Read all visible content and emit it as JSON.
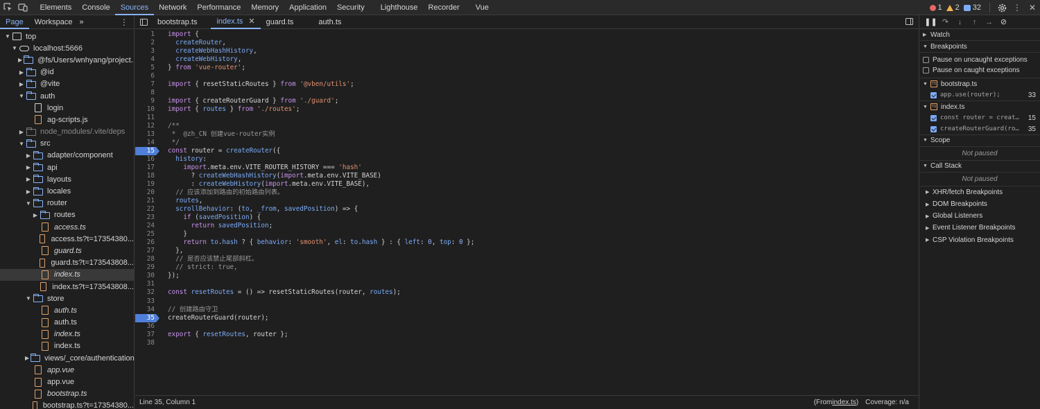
{
  "main_tabs": [
    "Elements",
    "Console",
    "Sources",
    "Network",
    "Performance",
    "Memory",
    "Application",
    "Security",
    "Lighthouse",
    "Recorder",
    "Vue"
  ],
  "active_main_tab": "Sources",
  "counts": {
    "errors": "1",
    "warnings": "2",
    "messages": "32"
  },
  "navigator": {
    "tabs": [
      "Page",
      "Workspace"
    ],
    "tree": [
      {
        "label": "top",
        "depth": 0,
        "arrow": "down",
        "icon": "frame"
      },
      {
        "label": "localhost:5666",
        "depth": 1,
        "arrow": "down",
        "icon": "cloud"
      },
      {
        "label": "@fs/Users/wnhyang/project...",
        "depth": 2,
        "arrow": "right",
        "icon": "folder"
      },
      {
        "label": "@id",
        "depth": 2,
        "arrow": "right",
        "icon": "folder"
      },
      {
        "label": "@vite",
        "depth": 2,
        "arrow": "right",
        "icon": "folder"
      },
      {
        "label": "auth",
        "depth": 2,
        "arrow": "down",
        "icon": "folder"
      },
      {
        "label": "login",
        "depth": 3,
        "arrow": "none",
        "icon": "file-white"
      },
      {
        "label": "ag-scripts.js",
        "depth": 3,
        "arrow": "none",
        "icon": "file"
      },
      {
        "label": "node_modules/.vite/deps",
        "depth": 2,
        "arrow": "right",
        "icon": "folder-dim",
        "dim": true
      },
      {
        "label": "src",
        "depth": 2,
        "arrow": "down",
        "icon": "folder"
      },
      {
        "label": "adapter/component",
        "depth": 3,
        "arrow": "right",
        "icon": "folder"
      },
      {
        "label": "api",
        "depth": 3,
        "arrow": "right",
        "icon": "folder"
      },
      {
        "label": "layouts",
        "depth": 3,
        "arrow": "right",
        "icon": "folder"
      },
      {
        "label": "locales",
        "depth": 3,
        "arrow": "right",
        "icon": "folder"
      },
      {
        "label": "router",
        "depth": 3,
        "arrow": "down",
        "icon": "folder"
      },
      {
        "label": "routes",
        "depth": 4,
        "arrow": "right",
        "icon": "folder"
      },
      {
        "label": "access.ts",
        "depth": 4,
        "arrow": "none",
        "icon": "file",
        "italic": true
      },
      {
        "label": "access.ts?t=17354380...",
        "depth": 4,
        "arrow": "none",
        "icon": "file"
      },
      {
        "label": "guard.ts",
        "depth": 4,
        "arrow": "none",
        "icon": "file",
        "italic": true
      },
      {
        "label": "guard.ts?t=173543808...",
        "depth": 4,
        "arrow": "none",
        "icon": "file"
      },
      {
        "label": "index.ts",
        "depth": 4,
        "arrow": "none",
        "icon": "file",
        "italic": true,
        "selected": true
      },
      {
        "label": "index.ts?t=173543808...",
        "depth": 4,
        "arrow": "none",
        "icon": "file"
      },
      {
        "label": "store",
        "depth": 3,
        "arrow": "down",
        "icon": "folder"
      },
      {
        "label": "auth.ts",
        "depth": 4,
        "arrow": "none",
        "icon": "file",
        "italic": true
      },
      {
        "label": "auth.ts",
        "depth": 4,
        "arrow": "none",
        "icon": "file"
      },
      {
        "label": "index.ts",
        "depth": 4,
        "arrow": "none",
        "icon": "file",
        "italic": true
      },
      {
        "label": "index.ts",
        "depth": 4,
        "arrow": "none",
        "icon": "file"
      },
      {
        "label": "views/_core/authentication",
        "depth": 3,
        "arrow": "right",
        "icon": "folder"
      },
      {
        "label": "app.vue",
        "depth": 3,
        "arrow": "none",
        "icon": "file",
        "italic": true
      },
      {
        "label": "app.vue",
        "depth": 3,
        "arrow": "none",
        "icon": "file"
      },
      {
        "label": "bootstrap.ts",
        "depth": 3,
        "arrow": "none",
        "icon": "file",
        "italic": true
      },
      {
        "label": "bootstrap.ts?t=17354380...",
        "depth": 3,
        "arrow": "none",
        "icon": "file"
      }
    ]
  },
  "editor": {
    "tabs": [
      {
        "label": "bootstrap.ts",
        "active": false
      },
      {
        "label": "index.ts",
        "active": true,
        "close": "✕"
      },
      {
        "label": "guard.ts",
        "active": false
      },
      {
        "label": "auth.ts",
        "active": false
      }
    ],
    "breakpoint_lines": [
      15,
      35
    ],
    "lines": [
      "import {",
      "  createRouter,",
      "  createWebHashHistory,",
      "  createWebHistory,",
      "} from 'vue-router';",
      "",
      "import { resetStaticRoutes } from '@vben/utils';",
      "",
      "import { createRouterGuard } from './guard';",
      "import { routes } from './routes';",
      "",
      "/**",
      " *  @zh_CN 创建vue-router实例",
      " */",
      "const router = createRouter({",
      "  history:",
      "    import.meta.env.VITE_ROUTER_HISTORY === 'hash'",
      "      ? createWebHashHistory(import.meta.env.VITE_BASE)",
      "      : createWebHistory(import.meta.env.VITE_BASE),",
      "  // 应该添加到路由的初始路由列表。",
      "  routes,",
      "  scrollBehavior: (to, _from, savedPosition) => {",
      "    if (savedPosition) {",
      "      return savedPosition;",
      "    }",
      "    return to.hash ? { behavior: 'smooth', el: to.hash } : { left: 0, top: 0 };",
      "  },",
      "  // 是否应该禁止尾部斜杠。",
      "  // strict: true,",
      "});",
      "",
      "const resetRoutes = () => resetStaticRoutes(router, routes);",
      "",
      "// 创建路由守卫",
      "createRouterGuard(router);",
      "",
      "export { resetRoutes, router };",
      ""
    ],
    "status_left": "Line 35, Column 1",
    "status_from_prefix": "(From ",
    "status_from_link": "index.ts",
    "status_from_suffix": ")",
    "status_coverage": "Coverage: n/a"
  },
  "debugger": {
    "watch": "Watch",
    "breakpoints": "Breakpoints",
    "pause_uncaught": "Pause on uncaught exceptions",
    "pause_caught": "Pause on caught exceptions",
    "bp_files": [
      {
        "file": "bootstrap.ts",
        "items": [
          {
            "code": "app.use(router);",
            "line": "33"
          }
        ]
      },
      {
        "file": "index.ts",
        "items": [
          {
            "code": "const router = create...",
            "line": "15"
          },
          {
            "code": "createRouterGuard(rou...",
            "line": "35"
          }
        ]
      }
    ],
    "scope": "Scope",
    "not_paused": "Not paused",
    "call_stack": "Call Stack",
    "collapsed_sections": [
      "XHR/fetch Breakpoints",
      "DOM Breakpoints",
      "Global Listeners",
      "Event Listener Breakpoints",
      "CSP Violation Breakpoints"
    ]
  }
}
